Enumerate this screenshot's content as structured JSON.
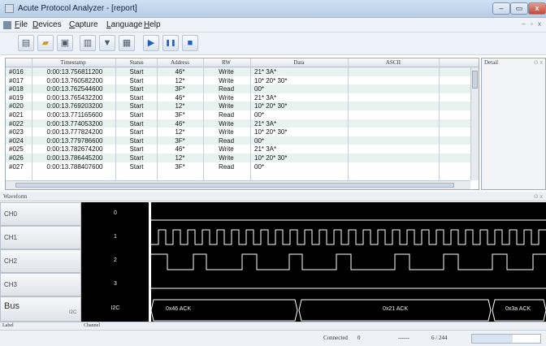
{
  "window": {
    "title": "Acute Protocol Analyzer - [report]",
    "minimize": "–",
    "maximize": "▭",
    "close": "x"
  },
  "menu": [
    "File",
    "Devices",
    "Capture",
    "Language",
    "Help"
  ],
  "mdi_controls": "– ▫ x",
  "toolbar": {
    "icons": [
      "document-icon",
      "open-folder-icon",
      "save-icon",
      "export-icon",
      "filter-icon",
      "image-icon",
      "play-icon",
      "pause-icon",
      "stop-icon"
    ],
    "glyphs": [
      "▤",
      "▰",
      "▣",
      "▥",
      "▼",
      "▦",
      "▶",
      "❚❚",
      "■"
    ]
  },
  "table": {
    "columns": [
      "Timestamp",
      "Status",
      "Address",
      "RW",
      "Data",
      "ASCII"
    ],
    "rows": [
      [
        "#016",
        "0:00:13.756811200",
        "Start",
        "46*",
        "Write",
        "21* 3A*",
        ""
      ],
      [
        "#017",
        "0:00:13.760582200",
        "Start",
        "12*",
        "Write",
        "10* 20* 30*",
        ""
      ],
      [
        "#018",
        "0:00:13.762544600",
        "Start",
        "3F*",
        "Read",
        "00*",
        ""
      ],
      [
        "#019",
        "0:00:13.765432200",
        "Start",
        "46*",
        "Write",
        "21* 3A*",
        ""
      ],
      [
        "#020",
        "0:00:13.769203200",
        "Start",
        "12*",
        "Write",
        "10* 20* 30*",
        ""
      ],
      [
        "#021",
        "0:00:13.771165600",
        "Start",
        "3F*",
        "Read",
        "00*",
        ""
      ],
      [
        "#022",
        "0:00:13.774053200",
        "Start",
        "46*",
        "Write",
        "21* 3A*",
        ""
      ],
      [
        "#023",
        "0:00:13.777824200",
        "Start",
        "12*",
        "Write",
        "10* 20* 30*",
        ""
      ],
      [
        "#024",
        "0:00:13.779786600",
        "Start",
        "3F*",
        "Read",
        "00*",
        ""
      ],
      [
        "#025",
        "0:00:13.782674200",
        "Start",
        "46*",
        "Write",
        "21* 3A*",
        ""
      ],
      [
        "#026",
        "0:00:13.786445200",
        "Start",
        "12*",
        "Write",
        "10* 20* 30*",
        ""
      ],
      [
        "#027",
        "0:00:13.788407600",
        "Start",
        "3F*",
        "Read",
        "00*",
        ""
      ]
    ]
  },
  "detail": {
    "title": "Detail",
    "close": "⊙ x"
  },
  "waveform": {
    "title": "Waveform",
    "pin": "⊙ x",
    "channels": [
      {
        "label": "CH0",
        "channel": "0"
      },
      {
        "label": "CH1",
        "channel": "1"
      },
      {
        "label": "CH2",
        "channel": "2"
      },
      {
        "label": "CH3",
        "channel": "3"
      },
      {
        "label": "Bus",
        "channel": "I2C",
        "tag": "I2C"
      }
    ],
    "bus_segments": [
      "0x46 ACK",
      "0x21 ACK",
      "0x3a ACK"
    ]
  },
  "bottom_bar": {
    "label": "Label",
    "channel": "Channel"
  },
  "status": {
    "connection": "Connected",
    "count": "0",
    "separator": "------",
    "page": "6 / 244",
    "progress": 0.6
  },
  "colors": {
    "row_stripe": "#e8f3ef",
    "wave": "#ffffff",
    "background": "#000000"
  }
}
